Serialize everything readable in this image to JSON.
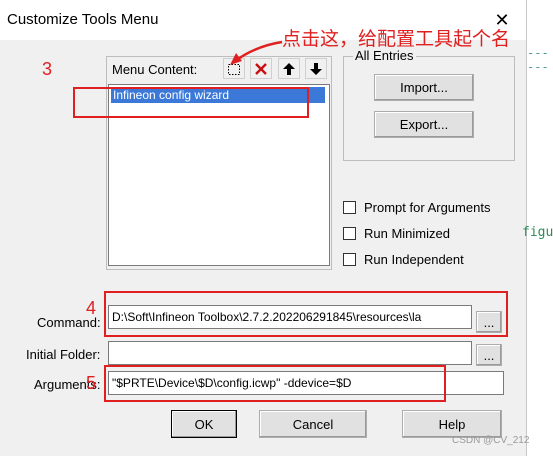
{
  "window": {
    "title": "Customize Tools Menu",
    "close_glyph": "✕"
  },
  "menu_content": {
    "label": "Menu Content:",
    "items": [
      "Infineon config wizard"
    ]
  },
  "all_entries": {
    "label": "All Entries",
    "import_label": "Import...",
    "export_label": "Export..."
  },
  "options": {
    "prompt": "Prompt for  Arguments",
    "minimized": "Run Minimized",
    "independent": "Run Independent"
  },
  "form": {
    "command_label": "Command:",
    "command_value": "D:\\Soft\\Infineon Toolbox\\2.7.2.202206291845\\resources\\la",
    "folder_label": "Initial Folder:",
    "folder_value": "",
    "arguments_label": "Arguments:",
    "arguments_value": "\"$PRTE\\Device\\$D\\config.icwp\" -ddevice=$D",
    "browse_label": "..."
  },
  "buttons": {
    "ok": "OK",
    "cancel": "Cancel",
    "help": "Help"
  },
  "annotations": {
    "step3": "3",
    "step4": "4",
    "step5": "5",
    "note": "点击这，给配置工具起个名"
  },
  "background": {
    "dashes": "------",
    "code_fragment": "figu",
    "watermark": "CSDN @CV_212"
  },
  "colors": {
    "annotation": "#e02020",
    "selection": "#3b78d8",
    "code": "#2e8b57"
  }
}
